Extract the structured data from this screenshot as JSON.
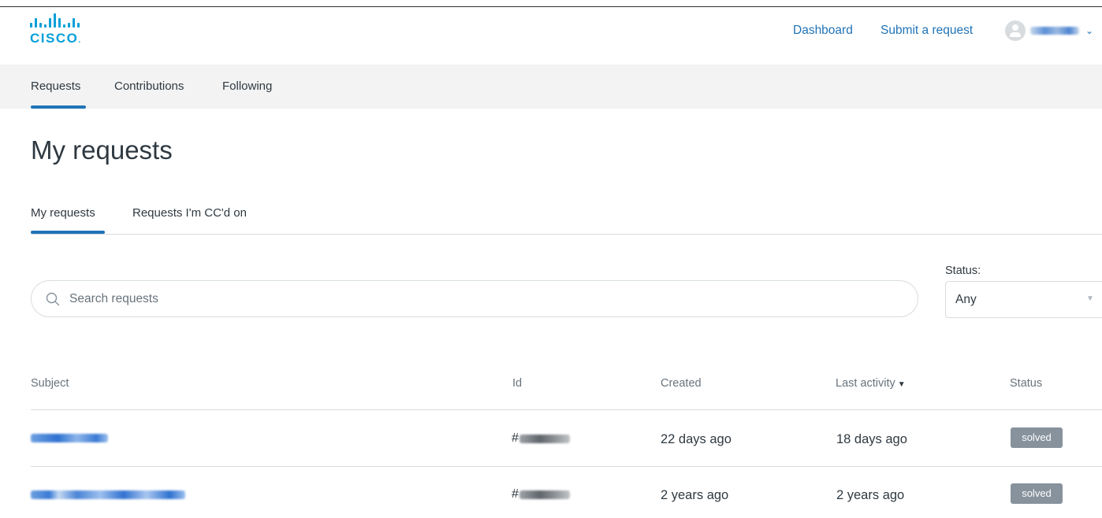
{
  "header": {
    "logo_text": "CISCO",
    "nav": {
      "dashboard": "Dashboard",
      "submit": "Submit a request"
    },
    "user_chevron": "⌄"
  },
  "subnav": {
    "items": [
      {
        "label": "Requests",
        "active": true
      },
      {
        "label": "Contributions",
        "active": false
      },
      {
        "label": "Following",
        "active": false
      }
    ]
  },
  "page": {
    "title": "My requests"
  },
  "tabs": [
    {
      "label": "My requests",
      "active": true
    },
    {
      "label": "Requests I'm CC'd on",
      "active": false
    }
  ],
  "search": {
    "placeholder": "Search requests",
    "value": ""
  },
  "filter": {
    "label": "Status:",
    "selected": "Any"
  },
  "table": {
    "headers": {
      "subject": "Subject",
      "id": "Id",
      "created": "Created",
      "activity": "Last activity",
      "status": "Status"
    },
    "sort_indicator": "▼",
    "rows": [
      {
        "id_prefix": "#",
        "created": "22 days ago",
        "activity": "18 days ago",
        "status": "solved"
      },
      {
        "id_prefix": "#",
        "created": "2 years ago",
        "activity": "2 years ago",
        "status": "solved"
      }
    ]
  },
  "colors": {
    "brand": "#049fd9",
    "link": "#1f73b7",
    "badge": "#87929d",
    "subnav_bg": "#f3f3f3"
  }
}
